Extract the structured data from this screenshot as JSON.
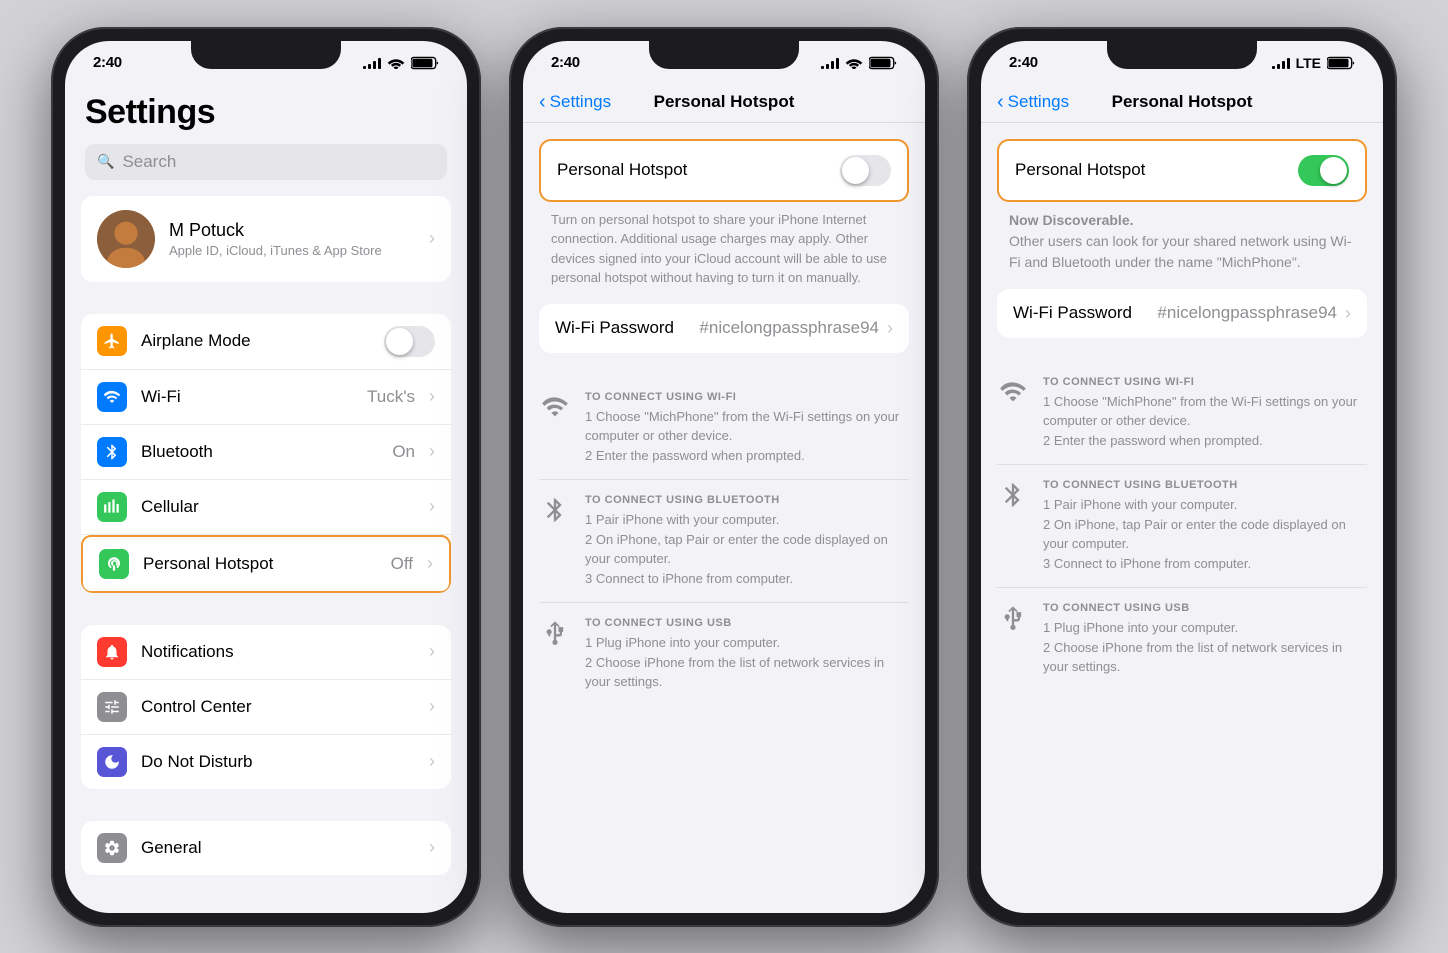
{
  "phone1": {
    "status": {
      "time": "2:40",
      "lte": false
    },
    "title": "Settings",
    "search_placeholder": "Search",
    "profile": {
      "name": "M Potuck",
      "subtitle": "Apple ID, iCloud, iTunes & App Store"
    },
    "section1": [
      {
        "label": "Airplane Mode",
        "icon_bg": "#ff9500",
        "icon": "airplane",
        "toggle": true,
        "toggle_on": false,
        "value": "",
        "chevron": false
      },
      {
        "label": "Wi-Fi",
        "icon_bg": "#007aff",
        "icon": "wifi",
        "toggle": false,
        "value": "Tuck's",
        "chevron": true
      },
      {
        "label": "Bluetooth",
        "icon_bg": "#007aff",
        "icon": "bluetooth",
        "toggle": false,
        "value": "On",
        "chevron": true
      },
      {
        "label": "Cellular",
        "icon_bg": "#34c759",
        "icon": "cellular",
        "toggle": false,
        "value": "",
        "chevron": true
      },
      {
        "label": "Personal Hotspot",
        "icon_bg": "#34c759",
        "icon": "hotspot",
        "toggle": false,
        "value": "Off",
        "chevron": true,
        "highlighted": true
      }
    ],
    "section2": [
      {
        "label": "Notifications",
        "icon_bg": "#ff3b30",
        "icon": "bell",
        "value": "",
        "chevron": true
      },
      {
        "label": "Control Center",
        "icon_bg": "#8e8e93",
        "icon": "sliders",
        "value": "",
        "chevron": true
      },
      {
        "label": "Do Not Disturb",
        "icon_bg": "#5856d6",
        "icon": "moon",
        "value": "",
        "chevron": true
      }
    ],
    "section3": [
      {
        "label": "General",
        "icon_bg": "#8e8e93",
        "icon": "gear",
        "value": "",
        "chevron": true
      }
    ]
  },
  "phone2": {
    "status": {
      "time": "2:40",
      "lte": false
    },
    "nav_back": "Settings",
    "nav_title": "Personal Hotspot",
    "hotspot_toggle": {
      "label": "Personal Hotspot",
      "on": false
    },
    "description": "Turn on personal hotspot to share your iPhone Internet connection. Additional usage charges may apply. Other devices signed into your iCloud account will be able to use personal hotspot without having to turn it on manually.",
    "wifi_password_label": "Wi-Fi Password",
    "wifi_password_value": "#nicelongpassphrase94",
    "connect_sections": [
      {
        "icon": "wifi",
        "heading": "TO CONNECT USING WI-FI",
        "steps": [
          "1 Choose \"MichPhone\" from the Wi-Fi settings on your computer or other device.",
          "2 Enter the password when prompted."
        ]
      },
      {
        "icon": "bluetooth",
        "heading": "TO CONNECT USING BLUETOOTH",
        "steps": [
          "1 Pair iPhone with your computer.",
          "2 On iPhone, tap Pair or enter the code displayed on your computer.",
          "3 Connect to iPhone from computer."
        ]
      },
      {
        "icon": "usb",
        "heading": "TO CONNECT USING USB",
        "steps": [
          "1 Plug iPhone into your computer.",
          "2 Choose iPhone from the list of network services in your settings."
        ]
      }
    ]
  },
  "phone3": {
    "status": {
      "time": "2:40",
      "lte": true
    },
    "nav_back": "Settings",
    "nav_title": "Personal Hotspot",
    "hotspot_toggle": {
      "label": "Personal Hotspot",
      "on": true
    },
    "discoverable_title": "Now Discoverable.",
    "discoverable_desc": "Other users can look for your shared network using Wi-Fi and Bluetooth under the name \"MichPhone\".",
    "wifi_password_label": "Wi-Fi Password",
    "wifi_password_value": "#nicelongpassphrase94",
    "connect_sections": [
      {
        "icon": "wifi",
        "heading": "TO CONNECT USING WI-FI",
        "steps": [
          "1 Choose \"MichPhone\" from the Wi-Fi settings on your computer or other device.",
          "2 Enter the password when prompted."
        ]
      },
      {
        "icon": "bluetooth",
        "heading": "TO CONNECT USING BLUETOOTH",
        "steps": [
          "1 Pair iPhone with your computer.",
          "2 On iPhone, tap Pair or enter the code displayed on your computer.",
          "3 Connect to iPhone from computer."
        ]
      },
      {
        "icon": "usb",
        "heading": "TO CONNECT USING USB",
        "steps": [
          "1 Plug iPhone into your computer.",
          "2 Choose iPhone from the list of network services in your settings."
        ]
      }
    ]
  }
}
